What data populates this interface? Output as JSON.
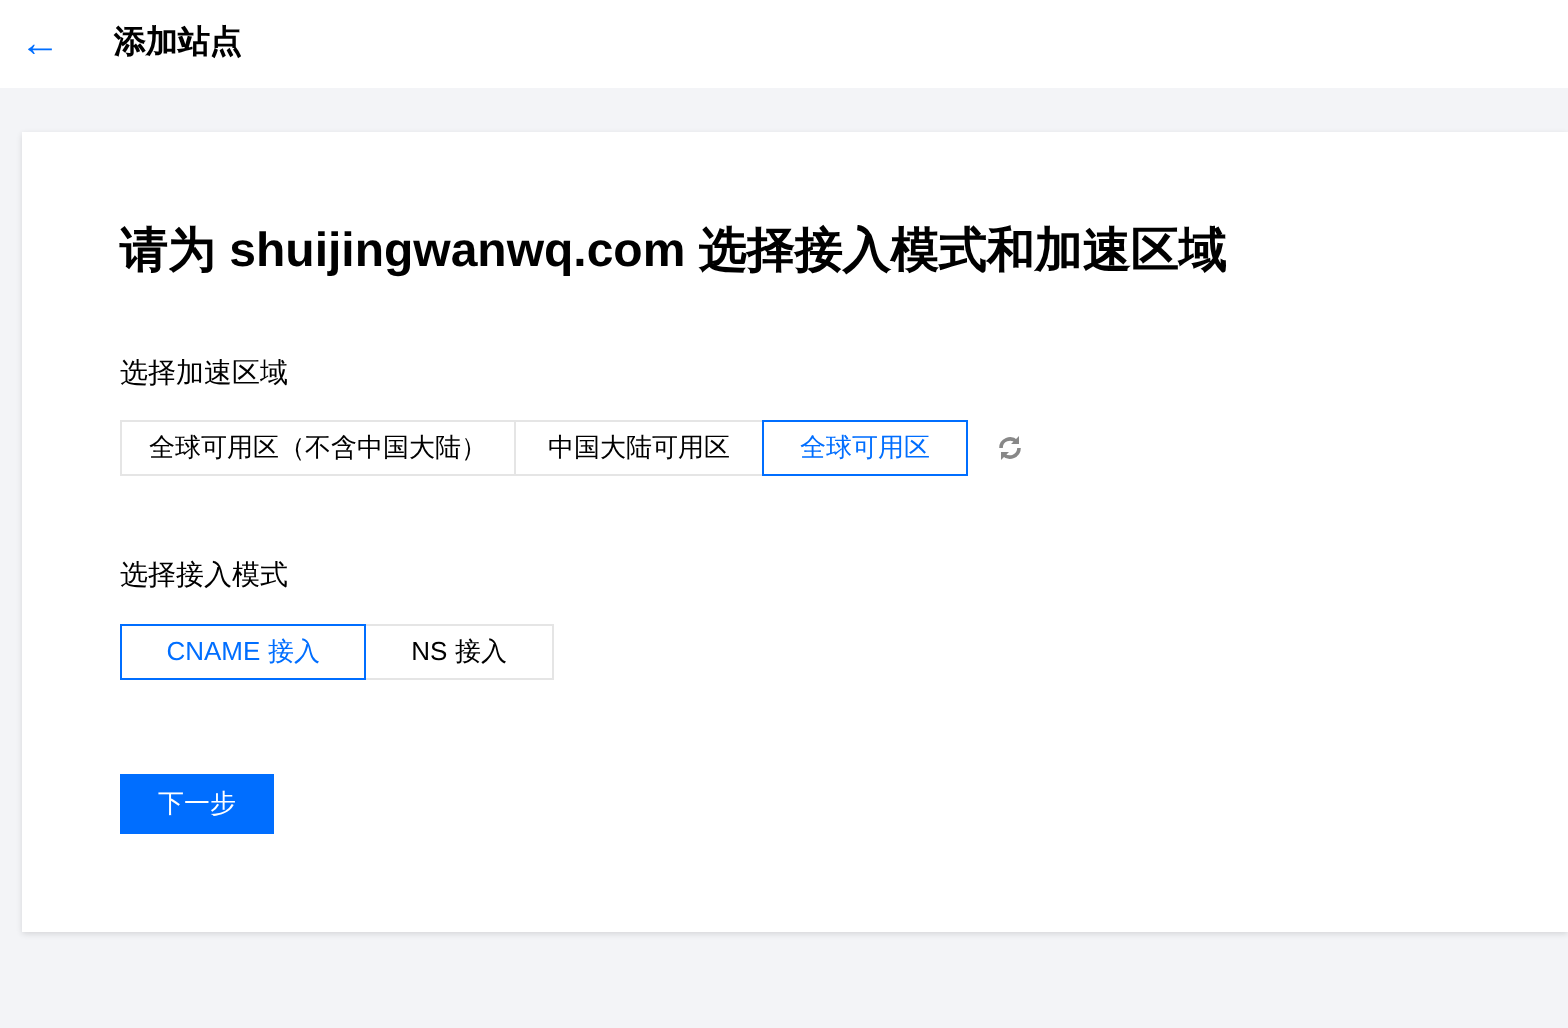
{
  "header": {
    "back_icon": "←",
    "title": "添加站点"
  },
  "heading": "请为 shuijingwanwq.com 选择接入模式和加速区域",
  "region": {
    "label": "选择加速区域",
    "options": [
      {
        "label": "全球可用区（不含中国大陆）",
        "selected": false
      },
      {
        "label": "中国大陆可用区",
        "selected": false
      },
      {
        "label": "全球可用区",
        "selected": true
      }
    ]
  },
  "mode": {
    "label": "选择接入模式",
    "options": [
      {
        "label": "CNAME 接入",
        "selected": true
      },
      {
        "label": "NS 接入",
        "selected": false
      }
    ]
  },
  "next_button": "下一步"
}
